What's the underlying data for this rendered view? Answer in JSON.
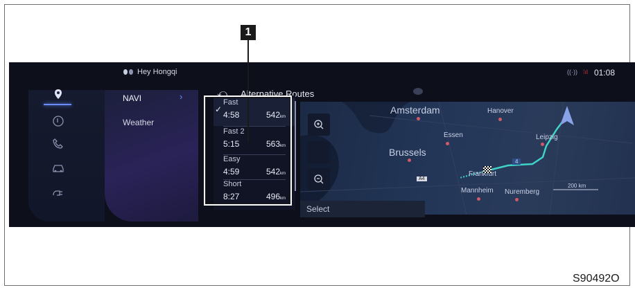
{
  "status_bar": {
    "assistant_label": "Hey Hongqi",
    "time": "01:08"
  },
  "header": {
    "title": "Alternative Routes"
  },
  "menu": {
    "items": [
      {
        "label": "NAVI",
        "active": true
      },
      {
        "label": "Weather",
        "active": false
      }
    ]
  },
  "sidebar": {
    "icons": [
      "navigation-icon",
      "music-icon",
      "phone-icon",
      "car-icon",
      "charging-icon"
    ]
  },
  "routes": [
    {
      "name": "Fast",
      "time": "4:58",
      "distance": "542",
      "unit": "km",
      "selected": true
    },
    {
      "name": "Fast 2",
      "time": "5:15",
      "distance": "563",
      "unit": "km",
      "selected": false
    },
    {
      "name": "Easy",
      "time": "4:59",
      "distance": "542",
      "unit": "km",
      "selected": false
    },
    {
      "name": "Short",
      "time": "8:27",
      "distance": "496",
      "unit": "km",
      "selected": false
    }
  ],
  "select_label": "Select",
  "map": {
    "cities": [
      "Amsterdam",
      "Hanover",
      "Essen",
      "Leipzig",
      "Brussels",
      "Frankfurt",
      "Mannheim",
      "Nuremberg"
    ],
    "road_badges": [
      "4",
      "A4"
    ],
    "scale": "200 km"
  },
  "callout": {
    "number": "1"
  },
  "figure_code": "S90492O",
  "colors": {
    "route_line": "#3fd3c9",
    "accent": "#6a8cff",
    "city_dot": "#d05a6a"
  }
}
